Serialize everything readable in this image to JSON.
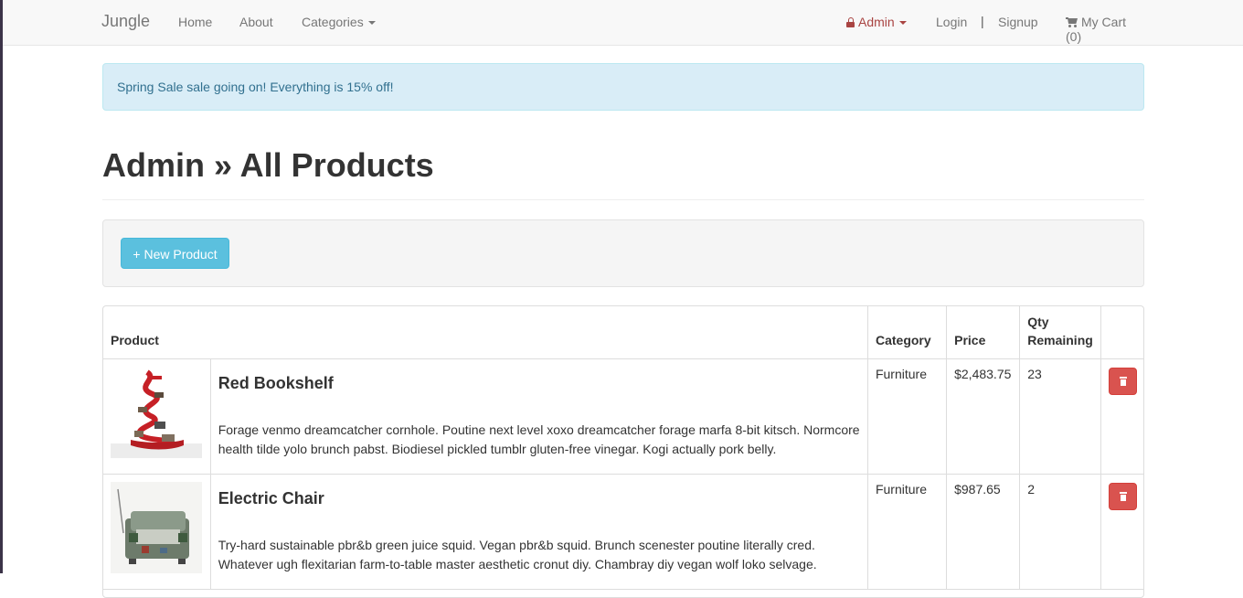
{
  "navbar": {
    "brand": "Jungle",
    "links": {
      "home": "Home",
      "about": "About",
      "categories": "Categories"
    },
    "admin": "Admin",
    "login": "Login",
    "separator": "|",
    "signup": "Signup",
    "cart": "My Cart (0)"
  },
  "alert": {
    "text": "Spring Sale sale going on! Everything is 15% off!"
  },
  "page": {
    "title": "Admin » All Products",
    "new_product_label": "+ New Product"
  },
  "table": {
    "headers": {
      "product": "Product",
      "category": "Category",
      "price": "Price",
      "qty": "Qty Remaining"
    },
    "rows": [
      {
        "name": "Red Bookshelf",
        "description": "Forage venmo dreamcatcher cornhole. Poutine next level xoxo dreamcatcher forage marfa 8-bit kitsch. Normcore health tilde yolo brunch pabst. Biodiesel pickled tumblr gluten-free vinegar. Kogi actually pork belly.",
        "category": "Furniture",
        "price": "$2,483.75",
        "qty": "23"
      },
      {
        "name": "Electric Chair",
        "description": "Try-hard sustainable pbr&b green juice squid. Vegan pbr&b squid. Brunch scenester poutine literally cred. Whatever ugh flexitarian farm-to-table master aesthetic cronut diy. Chambray diy vegan wolf loko selvage.",
        "category": "Furniture",
        "price": "$987.65",
        "qty": "2"
      }
    ]
  },
  "colors": {
    "info": "#5bc0de",
    "danger": "#d9534f",
    "alert_bg": "#d9edf7",
    "admin": "#a94442"
  }
}
